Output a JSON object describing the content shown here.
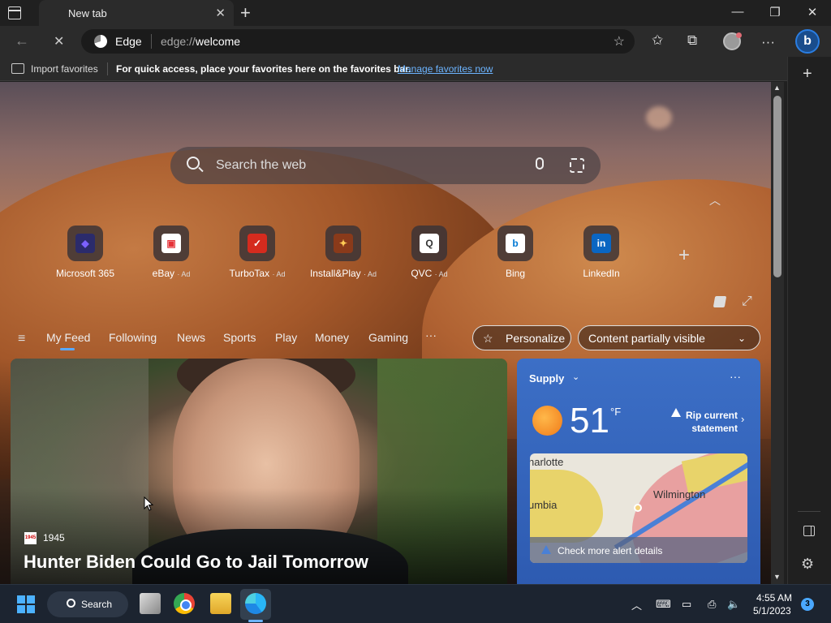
{
  "window": {
    "tab_title": "New tab",
    "tab_close": "✕",
    "new_tab": "+",
    "minimize": "—",
    "restore": "❐",
    "close": "✕"
  },
  "address_bar": {
    "back": "←",
    "reload": "✕",
    "site_name": "Edge",
    "url_prefix": "edge://",
    "url_path": "welcome",
    "favorite_icon": "☆",
    "favorites_icon": "✩",
    "collections_icon": "⧉",
    "more": "···",
    "bing": "b"
  },
  "favorites_bar": {
    "import_label": "Import favorites",
    "message": "For quick access, place your favorites here on the favorites bar.",
    "manage_link": "Manage favorites now"
  },
  "sidebar": {
    "add": "+",
    "settings": "⚙"
  },
  "search": {
    "placeholder": "Search the web"
  },
  "quick_links": [
    {
      "label": "Microsoft 365",
      "ad": "",
      "icon": "m365-icon",
      "glyph": "◆",
      "color": "#7b61ff",
      "bg": "#2b2b6b"
    },
    {
      "label": "eBay",
      "ad": "· Ad",
      "icon": "ebay-icon",
      "glyph": "▣",
      "color": "#e53238",
      "bg": "#ffffff"
    },
    {
      "label": "TurboTax",
      "ad": "· Ad",
      "icon": "turbotax-icon",
      "glyph": "✓",
      "color": "#ffffff",
      "bg": "#d52b1e"
    },
    {
      "label": "Install&Play",
      "ad": "· Ad",
      "icon": "installplay-icon",
      "glyph": "✦",
      "color": "#ffcc55",
      "bg": "#8a3a1a"
    },
    {
      "label": "QVC",
      "ad": "· Ad",
      "icon": "qvc-icon",
      "glyph": "Q",
      "color": "#333333",
      "bg": "#ffffff"
    },
    {
      "label": "Bing",
      "ad": "",
      "icon": "bing-icon",
      "glyph": "b",
      "color": "#0078d4",
      "bg": "#ffffff"
    },
    {
      "label": "LinkedIn",
      "ad": "",
      "icon": "linkedin-icon",
      "glyph": "in",
      "color": "#ffffff",
      "bg": "#0a66c2"
    }
  ],
  "add_tile": "+",
  "feed_nav": {
    "menu": "≡",
    "items": [
      "My Feed",
      "Following",
      "News",
      "Sports",
      "Play",
      "Money",
      "Gaming"
    ],
    "more": "···",
    "personalize": "Personalize",
    "content_visibility": "Content partially visible"
  },
  "hero": {
    "source": "1945",
    "source_logo": "1945",
    "title": "Hunter Biden Could Go to Jail Tomorrow"
  },
  "weather": {
    "location": "Supply",
    "temperature": "51",
    "unit": "°F",
    "alert": "Rip current statement",
    "map_labels": {
      "city1": "harlotte",
      "city2": "Wilmington",
      "city3": "umbia"
    },
    "alert_details": "Check more alert details"
  },
  "taskbar": {
    "search_label": "Search",
    "time": "4:55 AM",
    "date": "5/1/2023",
    "notifications": "3"
  }
}
